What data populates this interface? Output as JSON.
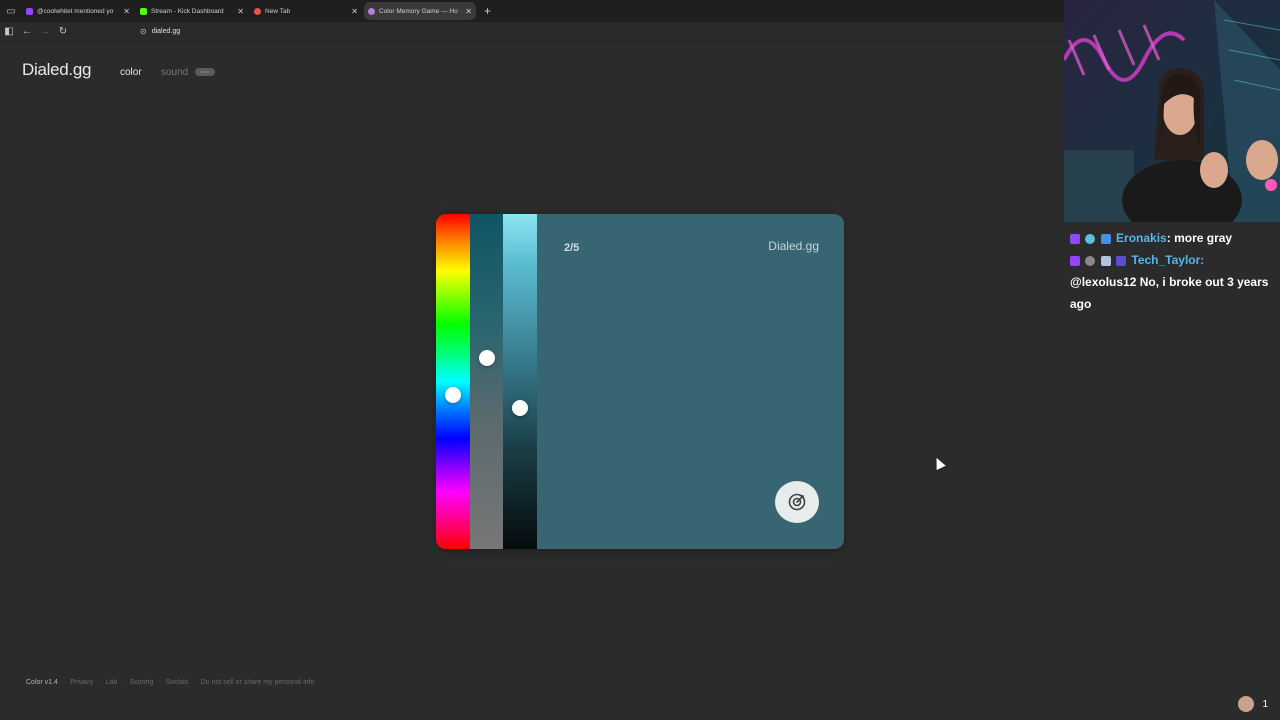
{
  "browser": {
    "tabs": [
      {
        "title": "@coolwhitet mentioned yo",
        "favicon_color": "#9146ff",
        "active": false
      },
      {
        "title": "Stream - Kick Dashboard",
        "favicon_color": "#53fc18",
        "active": false
      },
      {
        "title": "New Tab",
        "favicon_color": "#e05a4a",
        "active": false
      },
      {
        "title": "Color Memory Game — Ho",
        "favicon_color": "#b57bd9",
        "active": true
      }
    ],
    "url": "dialed.gg"
  },
  "site": {
    "logo": "Dialed.gg",
    "nav_color": "color",
    "nav_sound": "sound",
    "soon_badge": "soon"
  },
  "game": {
    "round": "2/5",
    "brand": "Dialed.gg",
    "target_color": "#376672",
    "hue_level": 0.54,
    "saturation_level": 0.43,
    "lightness_level": 0.58
  },
  "footer": {
    "items": [
      "Color v1.4",
      "Privacy",
      "Lab",
      "Scoring",
      "Socials",
      "Do not sell or share my personal info"
    ]
  },
  "chat": {
    "messages": [
      {
        "user": "Eronakis",
        "text": "more gray"
      },
      {
        "user": "Tech_Taylor",
        "text": "@lexolus12 No, i broke out 3 years ago"
      }
    ],
    "viewer_count": "1"
  }
}
